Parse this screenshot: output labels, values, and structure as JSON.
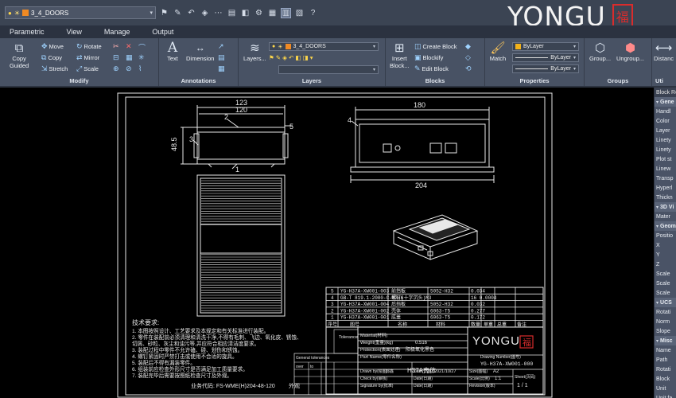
{
  "qat": {
    "layer_combo": "3_4_DOORS",
    "layer_combo_arrow": "▾"
  },
  "brand": {
    "name": "YONGU",
    "seal": "福"
  },
  "tabs": [
    "Parametric",
    "View",
    "Manage",
    "Output"
  ],
  "ribbon": {
    "modify": {
      "title": "Modify",
      "copy": "Copy",
      "guided": "Guided",
      "move": "Move",
      "rotate": "Rotate",
      "copy_small": "Copy",
      "mirror": "Mirror",
      "stretch": "Stretch",
      "scale": "Scale"
    },
    "annotations": {
      "title": "Annotations",
      "text": "Text",
      "dimension": "Dimension"
    },
    "layers": {
      "title": "Layers",
      "layers_btn": "Layers...",
      "layer_combo": "3_4_DOORS"
    },
    "blocks": {
      "title": "Blocks",
      "insert": "Insert",
      "block": "Block...",
      "create_block": "Create Block",
      "blockify": "Blockify",
      "edit_block": "Edit Block"
    },
    "properties": {
      "title": "Properties",
      "match": "Match",
      "bylayer_color": "ByLayer",
      "bylayer_linetype": "ByLayer",
      "bylayer_lineweight": "ByLayer"
    },
    "groups": {
      "title": "Groups",
      "group": "Group...",
      "ungroup": "Ungroup..."
    },
    "utilities": {
      "title": "Uti",
      "distance": "Distanc"
    }
  },
  "drawing": {
    "dims": {
      "w123": "123",
      "w120": "120",
      "h48_5": "48.5",
      "w180": "180",
      "w204": "204",
      "b1": "1",
      "b2": "2",
      "b3": "3",
      "b4": "4",
      "b5": "5"
    },
    "bom": [
      {
        "no": "5",
        "code": "YG-H37A-XW001-003",
        "name": "前挡板",
        "material": "5052-H32",
        "weight": "0.034"
      },
      {
        "no": "4",
        "code": "GB-T 819.1-2000-C-M3x6",
        "name": "螺钉(十字沉头)M3",
        "material": "",
        "weight": "16 0.0004"
      },
      {
        "no": "3",
        "code": "YG-H37A-XW001-004",
        "name": "后挡板",
        "material": "5052-H32",
        "weight": "0.032"
      },
      {
        "no": "2",
        "code": "YG-H37A-XW001-002",
        "name": "壳体",
        "material": "6063-T5",
        "weight": "0.277"
      },
      {
        "no": "1",
        "code": "YG-H37A-XW001-001",
        "name": "底盖",
        "material": "6063-T5",
        "weight": "0.172"
      }
    ],
    "bom_header": [
      "序号",
      "图号",
      "名称",
      "材料",
      "数量",
      "单重",
      "总重",
      "备注"
    ],
    "notes_title": "技术要求:",
    "notes": [
      "1. 本图按照设计、工艺要求及本规定和有关标准进行装配。",
      "2. 零件在装配前必须清理和清洗干净,不得有毛刺、飞边、氧化皮、锈蚀、",
      "   切屑、砂粒、灰尘和油污等,并应符合相应清洁度要求。",
      "3. 装配过程中零件不允许磕、碰、划伤和锈蚀。",
      "4. 螺钉紧固时严禁打击或使用不合适的旋具。",
      "5. 装配后不得有漏装零件。",
      "6. 组装前应检查外形尺寸是否满足加工质量要求。",
      "7. 装配完毕后需要按图纸检查尺寸及外观。"
    ],
    "business_code": "业务代码: FS-WME(H)204-48-120",
    "outer_label": "外观",
    "title_block": {
      "tolerance": "Tolerance",
      "material_label": "Material(材料)",
      "weight_label": "Weight(重量)(kg)",
      "weight_value": "0.516",
      "protection_label": "Protection(表面处理)",
      "protection_value": "阳极氧化黑色",
      "part_name_label": "Part Name(零件名称)",
      "part_name_value": "H37A壳体",
      "drawing_number_label": "Drawing Number(图号)",
      "drawing_number_value": "YG-H37A-XW001-000",
      "drawn_by": "Drawn by(绘图)",
      "drawn_name": "郭鑫",
      "date_label": "Date(日期)",
      "date_value": "2021/10/27",
      "check_by": "Check by(审核)",
      "signature_by": "Signature by(批准)",
      "size_label": "Size(图幅)",
      "size_value": "A2",
      "scale_label": "Scale(比例)",
      "scale_value": "1:1",
      "revision_label": "Revision(版本)",
      "sheet_label": "Sheet(页码)",
      "sheet_value": "1 / 1",
      "general_tol": "General tolerances",
      "over": "over",
      "to": "to",
      "brand": "YONGU",
      "seal": "福"
    }
  },
  "props_panel": {
    "header": "Block Ref",
    "rows": [
      {
        "type": "sect",
        "label": "Gene"
      },
      {
        "type": "row",
        "label": "Handl"
      },
      {
        "type": "row",
        "label": "Color"
      },
      {
        "type": "row",
        "label": "Layer"
      },
      {
        "type": "row",
        "label": "Linety"
      },
      {
        "type": "row",
        "label": "Linety"
      },
      {
        "type": "row",
        "label": "Plot st"
      },
      {
        "type": "row",
        "label": "Linew"
      },
      {
        "type": "row",
        "label": "Transp"
      },
      {
        "type": "row",
        "label": "Hyperl"
      },
      {
        "type": "row",
        "label": "Thickn"
      },
      {
        "type": "sect",
        "label": "3D Vi"
      },
      {
        "type": "row",
        "label": "Mater"
      },
      {
        "type": "sect",
        "label": "Geom"
      },
      {
        "type": "row",
        "label": "Positio"
      },
      {
        "type": "row",
        "label": "X"
      },
      {
        "type": "row",
        "label": "Y"
      },
      {
        "type": "row",
        "label": "Z"
      },
      {
        "type": "row",
        "label": "Scale"
      },
      {
        "type": "row",
        "label": "Scale"
      },
      {
        "type": "row",
        "label": "Scale"
      },
      {
        "type": "sect",
        "label": "UCS"
      },
      {
        "type": "row",
        "label": "Rotati"
      },
      {
        "type": "row",
        "label": "Norm"
      },
      {
        "type": "row",
        "label": "Slope"
      },
      {
        "type": "sect",
        "label": "Misc"
      },
      {
        "type": "row",
        "label": "Name"
      },
      {
        "type": "row",
        "label": "Path"
      },
      {
        "type": "row",
        "label": "Rotati"
      },
      {
        "type": "row",
        "label": "Block"
      },
      {
        "type": "row",
        "label": "Unit"
      },
      {
        "type": "row",
        "label": "Unit fa"
      }
    ]
  },
  "colors": {
    "ribbon": "#485264",
    "qat": "#3b4453",
    "canvas": "#000000",
    "brand_red": "#d92c2c"
  }
}
